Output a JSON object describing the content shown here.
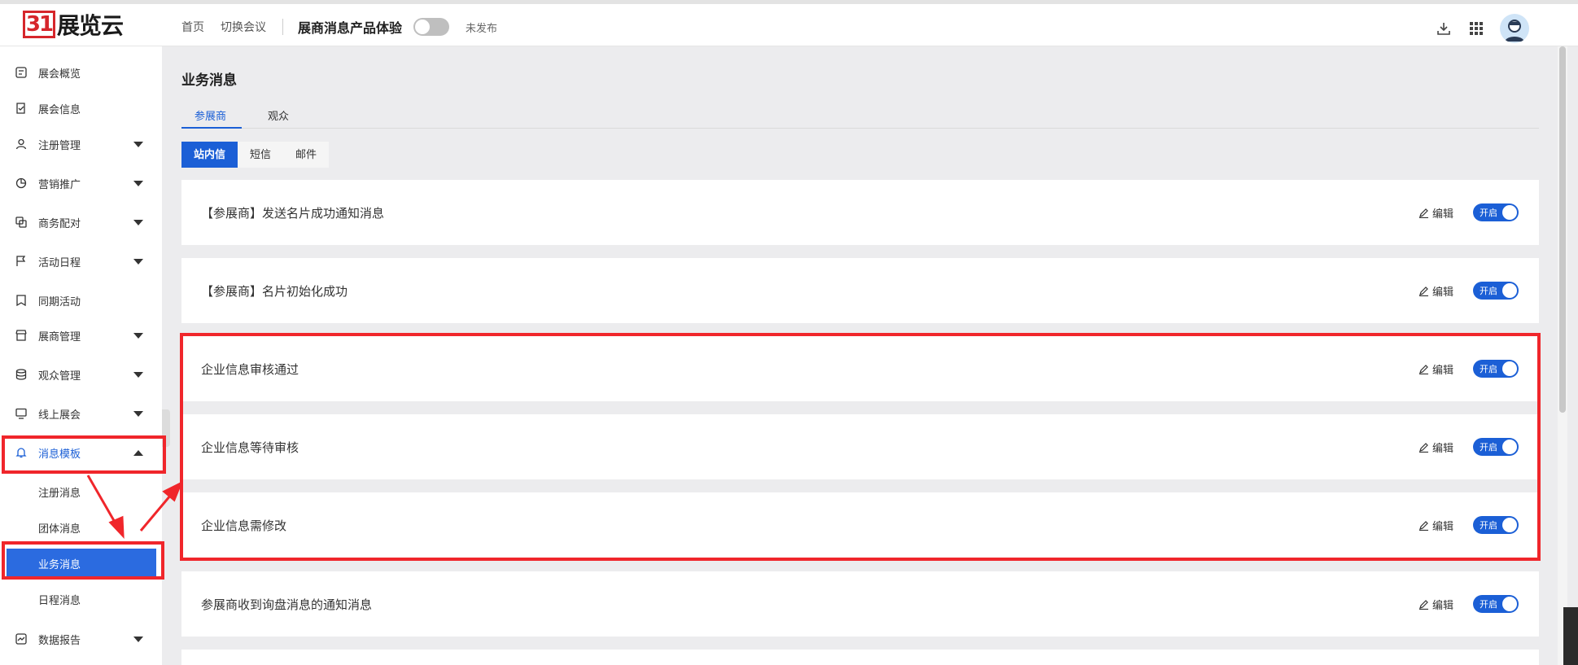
{
  "header": {
    "logo_badge": "31",
    "logo_text": "展览云",
    "nav": [
      "首页",
      "切换会议"
    ],
    "project_title": "展商消息产品体验",
    "publish_status": "未发布"
  },
  "sidebar": {
    "items": [
      {
        "label": "展会概览"
      },
      {
        "label": "展会信息"
      },
      {
        "label": "注册管理"
      },
      {
        "label": "营销推广"
      },
      {
        "label": "商务配对"
      },
      {
        "label": "活动日程"
      },
      {
        "label": "同期活动"
      },
      {
        "label": "展商管理"
      },
      {
        "label": "观众管理"
      },
      {
        "label": "线上展会"
      },
      {
        "label": "消息模板"
      },
      {
        "label": "数据报告"
      }
    ],
    "sub_items": [
      {
        "label": "注册消息"
      },
      {
        "label": "团体消息"
      },
      {
        "label": "业务消息"
      },
      {
        "label": "日程消息"
      }
    ]
  },
  "main": {
    "title": "业务消息",
    "tabs": [
      {
        "label": "参展商"
      },
      {
        "label": "观众"
      }
    ],
    "channels": [
      {
        "label": "站内信"
      },
      {
        "label": "短信"
      },
      {
        "label": "邮件"
      }
    ],
    "edit_label": "编辑",
    "toggle_label": "开启",
    "cards": [
      {
        "title": "【参展商】发送名片成功通知消息",
        "enabled": true
      },
      {
        "title": "【参展商】名片初始化成功",
        "enabled": true
      },
      {
        "title": "企业信息审核通过",
        "enabled": true
      },
      {
        "title": "企业信息等待审核",
        "enabled": true
      },
      {
        "title": "企业信息需修改",
        "enabled": true
      },
      {
        "title": "参展商收到询盘消息的通知消息",
        "enabled": true
      }
    ]
  },
  "colors": {
    "accent": "#1b5fd6",
    "annotation_red": "#f0262b"
  }
}
